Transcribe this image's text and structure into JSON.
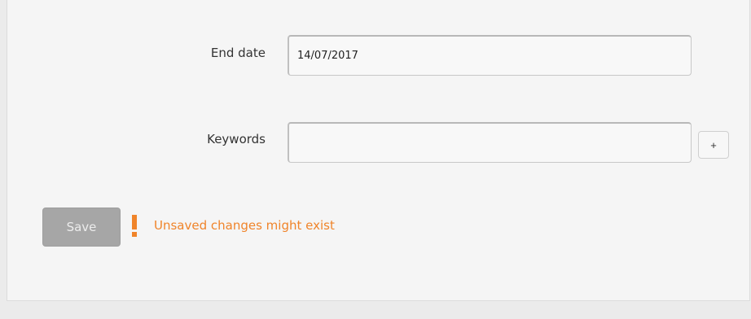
{
  "form": {
    "end_date_label": "End date",
    "end_date_value": "14/07/2017",
    "keywords_label": "Keywords",
    "keywords_value": "",
    "add_keyword_label": "+",
    "save_label": "Save",
    "warning_text": "Unsaved changes might exist"
  },
  "icons": {
    "warning": "exclamation-icon"
  },
  "colors": {
    "warning": "#f0842a",
    "save_button_bg": "#a6a6a6",
    "panel_bg": "#f5f5f5"
  }
}
